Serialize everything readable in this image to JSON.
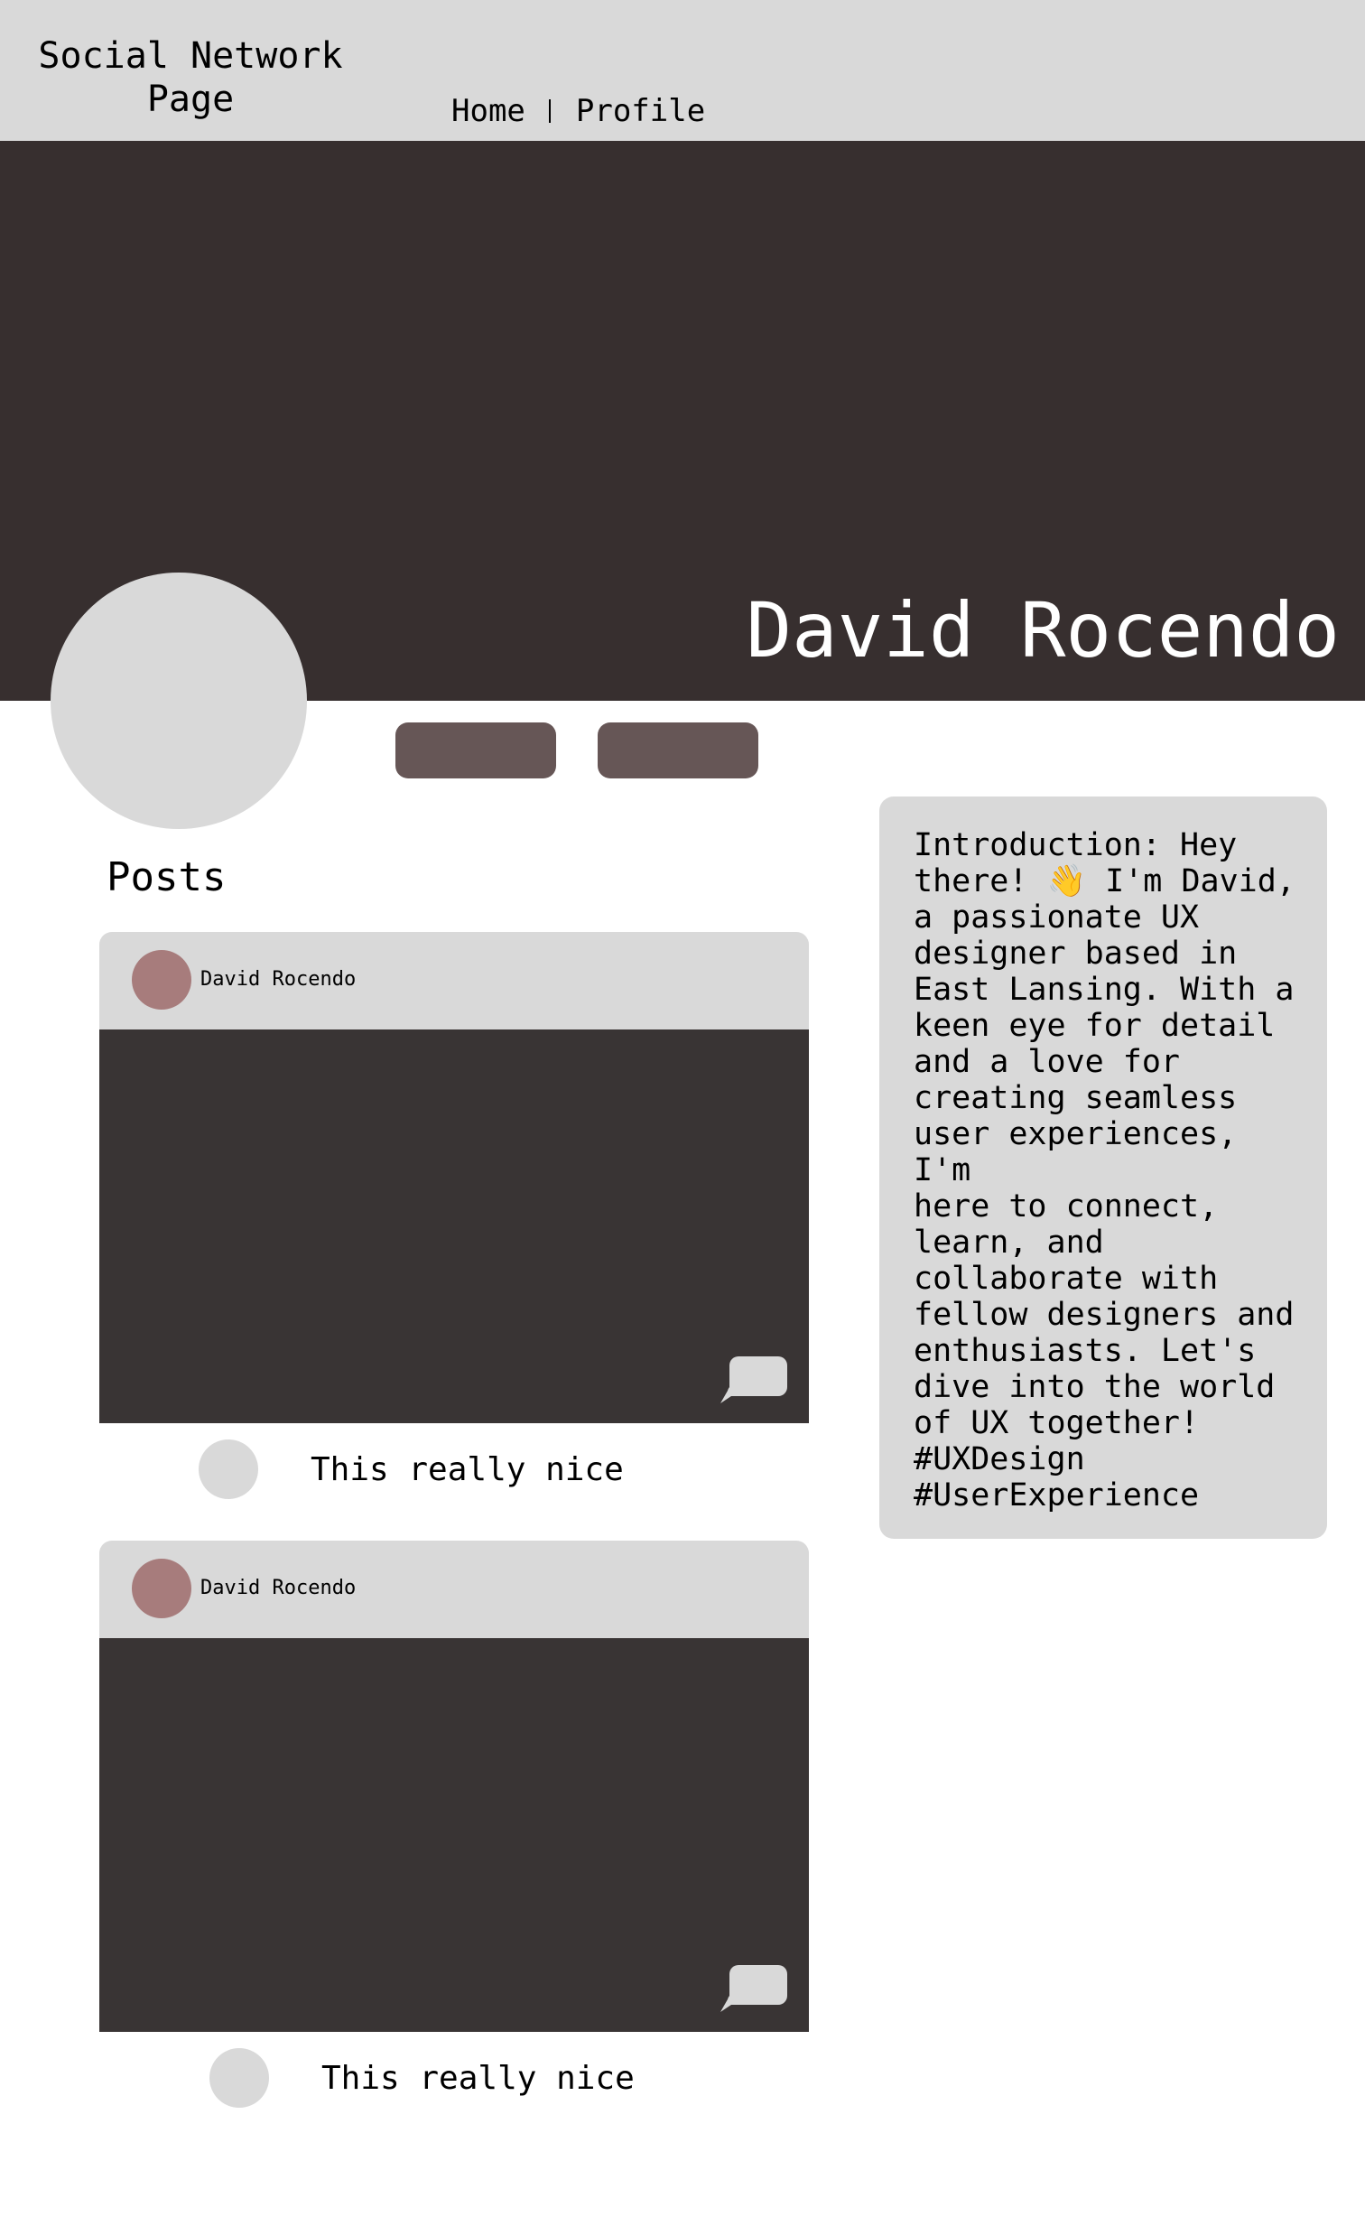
{
  "header": {
    "title": "Social Network\nPage",
    "nav": {
      "home_label": "Home",
      "profile_label": "Profile"
    }
  },
  "profile": {
    "name": "David Rocendo",
    "introduction": "Introduction: Hey\nthere! 👋 I'm David,\na passionate UX\ndesigner based in\nEast Lansing. With a\nkeen eye for detail\nand a love for\ncreating seamless\nuser experiences, I'm\nhere to connect,\nlearn, and\ncollaborate with\nfellow designers and\nenthusiasts. Let's\ndive into the world\nof UX together!\n#UXDesign\n#UserExperience"
  },
  "posts": {
    "heading": "Posts",
    "items": [
      {
        "author": "David Rocendo",
        "comment": "This really nice"
      },
      {
        "author": "David Rocendo",
        "comment": "This really nice"
      }
    ]
  },
  "colors": {
    "topbar": "#d9d9d9",
    "cover": "#372f2f",
    "post_image": "#393434",
    "action_button": "#665656",
    "post_avatar": "#a77c7c",
    "card": "#d9d9d9"
  },
  "icons": {
    "comment": "speech-bubble-icon"
  }
}
